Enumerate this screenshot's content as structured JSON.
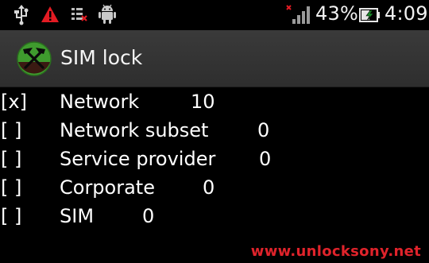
{
  "status_bar": {
    "icons": [
      "usb-icon",
      "warning-icon",
      "no-sim-icon",
      "android-debug-icon",
      "signal-icon",
      "battery-charging-icon"
    ],
    "battery_percent": "43%",
    "time": "4:09",
    "colors": {
      "warning": "#e31b23",
      "battery": "#ffffff"
    }
  },
  "action_bar": {
    "title": "SIM lock",
    "icon": "unlock-logo-icon"
  },
  "locks": [
    {
      "checkbox": "[x]",
      "label": "Network",
      "value": "10"
    },
    {
      "checkbox": "[ ]",
      "label": "Network subset",
      "value": "0"
    },
    {
      "checkbox": "[ ]",
      "label": "Service provider",
      "value": "0"
    },
    {
      "checkbox": "[ ]",
      "label": "Corporate",
      "value": "0"
    },
    {
      "checkbox": "[ ]",
      "label": "SIM",
      "value": "0"
    }
  ],
  "footer": {
    "watermark": "www.unlocksony.net",
    "color": "#e0232b"
  }
}
